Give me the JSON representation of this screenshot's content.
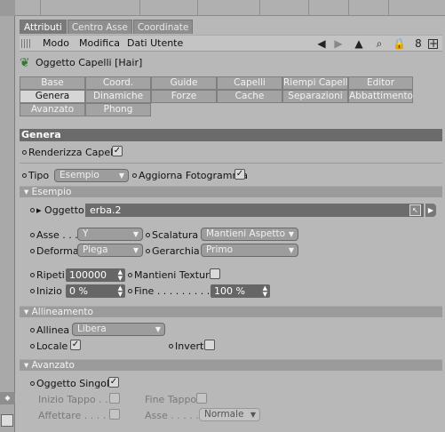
{
  "tabs": [
    "Attributi",
    "Centro Asse",
    "Coordinate"
  ],
  "menu": {
    "modo": "Modo",
    "modifica": "Modifica",
    "dati": "Dati Utente"
  },
  "object_title": "Oggetto Capelli [Hair]",
  "grid": [
    "Base",
    "Coord.",
    "Guide",
    "Capelli",
    "Riempi Capelli",
    "Editor",
    "Genera",
    "Dinamiche",
    "Forze",
    "Cache",
    "Separazioni",
    "Abbattimento",
    "Avanzato",
    "Phong"
  ],
  "section": "Genera",
  "render_hair": "Renderizza Capelli",
  "tipo_label": "Tipo",
  "tipo_value": "Esempio",
  "update_frame": "Aggiorna Fotogramma",
  "example_group": "Esempio",
  "object_label": "Oggetto",
  "object_value": "erba.2",
  "axis_label": "Asse",
  "axis_value": "Y",
  "scale_label": "Scalatura",
  "scale_value": "Mantieni Aspetto",
  "deform_label": "Deforma",
  "deform_value": "Piega",
  "hierarchy_label": "Gerarchia",
  "hierarchy_value": "Primo",
  "repeat_label": "Ripeti",
  "repeat_value": "100000",
  "keep_texture": "Mantieni Texture",
  "start_label": "Inizio",
  "start_value": "0 %",
  "end_label": "Fine . . . . . . . . .",
  "end_value": "100 %",
  "align_group": "Allineamento",
  "align_label": "Allinea",
  "align_value": "Libera",
  "local_label": "Locale",
  "invert_label": "Inverti",
  "advanced_group": "Avanzato",
  "single_object": "Oggetto Singolo",
  "start_cap": "Inizio Tappo . . .",
  "end_cap": "Fine Tappo",
  "taper": "Affettare . . . . . .",
  "axis2_label": "Asse . . . . . .",
  "axis2_value": "Normale",
  "colors": {
    "accent": "#6b6b6b",
    "field": "#666666",
    "background": "#b8b8b8"
  }
}
